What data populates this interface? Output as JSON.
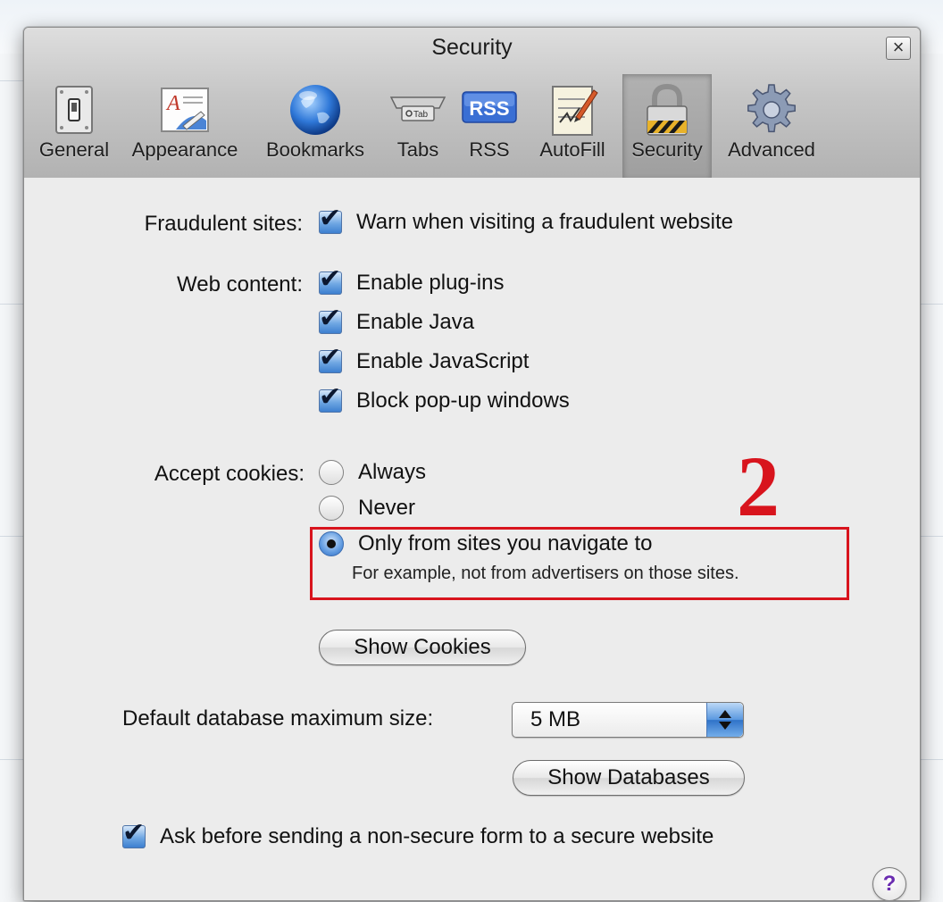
{
  "window": {
    "title": "Security",
    "close_glyph": "×"
  },
  "toolbar": {
    "items": [
      {
        "label": "General",
        "icon": "general-switch-icon",
        "selected": false
      },
      {
        "label": "Appearance",
        "icon": "appearance-icon",
        "selected": false
      },
      {
        "label": "Bookmarks",
        "icon": "globe-icon",
        "selected": false
      },
      {
        "label": "Tabs",
        "icon": "tabs-icon",
        "selected": false
      },
      {
        "label": "RSS",
        "icon": "rss-icon",
        "selected": false
      },
      {
        "label": "AutoFill",
        "icon": "autofill-icon",
        "selected": false
      },
      {
        "label": "Security",
        "icon": "lock-icon",
        "selected": true
      },
      {
        "label": "Advanced",
        "icon": "gear-icon",
        "selected": false
      }
    ],
    "tab_icon_text": "Tab",
    "rss_icon_text": "RSS"
  },
  "fraud": {
    "label": "Fraudulent sites:",
    "option": "Warn when visiting a fraudulent website",
    "checked": true
  },
  "web_content": {
    "label": "Web content:",
    "options": [
      {
        "label": "Enable plug-ins",
        "checked": true
      },
      {
        "label": "Enable Java",
        "checked": true
      },
      {
        "label": "Enable JavaScript",
        "checked": true
      },
      {
        "label": "Block pop-up windows",
        "checked": true
      }
    ]
  },
  "cookies": {
    "label": "Accept cookies:",
    "options": [
      {
        "label": "Always",
        "selected": false
      },
      {
        "label": "Never",
        "selected": false
      },
      {
        "label": "Only from sites you navigate to",
        "selected": true
      }
    ],
    "note": "For example, not from advertisers on those sites.",
    "show_cookies": "Show Cookies"
  },
  "database": {
    "label": "Default database maximum size:",
    "value": "5 MB",
    "show_databases": "Show Databases"
  },
  "secure_form": {
    "label": "Ask before sending a non-secure form to a secure website",
    "checked": true
  },
  "annotation": {
    "number": "2",
    "color": "#d8141d"
  },
  "help": "?",
  "check_glyph": "✔"
}
